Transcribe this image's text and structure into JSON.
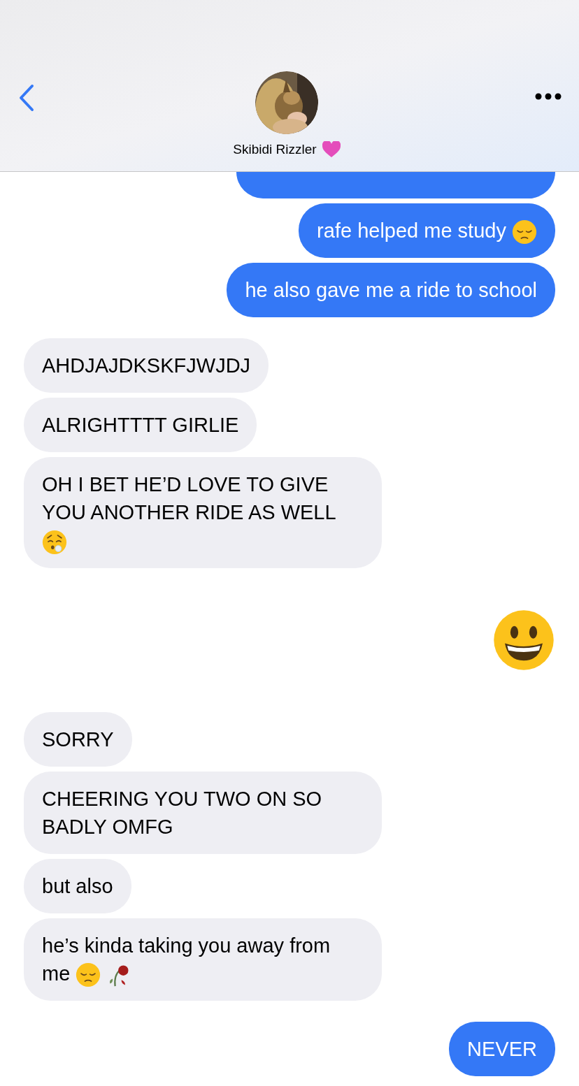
{
  "header": {
    "contact_name": "Skibidi Rizzler"
  },
  "messages": [
    {
      "sent": true,
      "kind": "partial"
    },
    {
      "sent": true,
      "kind": "text",
      "text": "rafe helped me study",
      "emojis": [
        {
          "kind": "pensive"
        }
      ]
    },
    {
      "sent": true,
      "kind": "text",
      "text": "he also gave me a ride to school"
    },
    {
      "sent": false,
      "kind": "text",
      "text": "AHDJAJDKSKFJWJDJ"
    },
    {
      "sent": false,
      "kind": "text",
      "text": "ALRIGHTTTT GIRLIE"
    },
    {
      "sent": false,
      "kind": "text",
      "text": "OH I BET HE’D LOVE TO GIVE YOU ANOTHER RIDE AS WELL",
      "emojis": [
        {
          "kind": "exhale"
        }
      ]
    },
    {
      "sent": true,
      "kind": "emoji",
      "emojis": [
        {
          "kind": "grinning"
        }
      ]
    },
    {
      "sent": false,
      "kind": "text",
      "text": "SORRY"
    },
    {
      "sent": false,
      "kind": "text",
      "text": "CHEERING YOU TWO ON SO BADLY OMFG"
    },
    {
      "sent": false,
      "kind": "text",
      "text": "but also"
    },
    {
      "sent": false,
      "kind": "text",
      "text": "he’s kinda taking you away from me",
      "emojis": [
        {
          "kind": "pensive"
        },
        {
          "kind": "rose"
        }
      ]
    },
    {
      "sent": true,
      "kind": "text",
      "text": "NEVER"
    }
  ]
}
